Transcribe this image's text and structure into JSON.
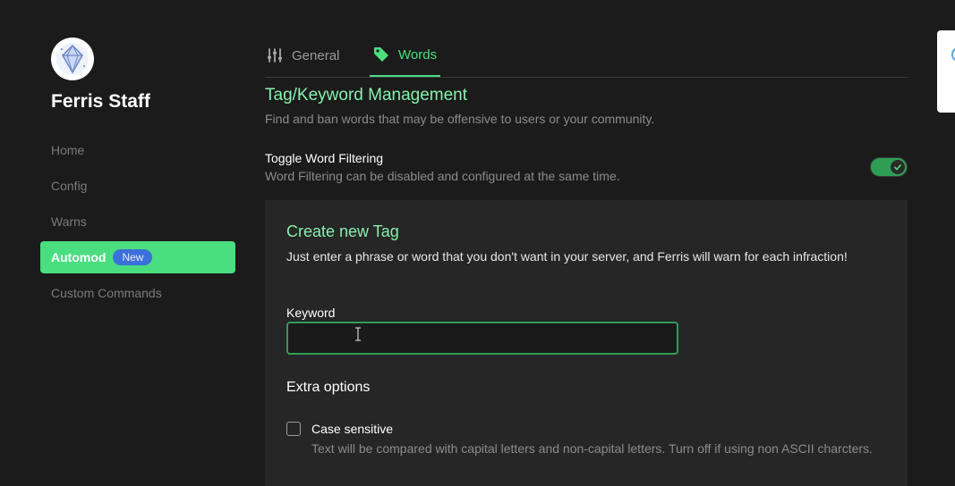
{
  "sidebar": {
    "server_name": "Ferris Staff",
    "items": [
      {
        "label": "Home"
      },
      {
        "label": "Config"
      },
      {
        "label": "Warns"
      },
      {
        "label": "Automod",
        "badge": "New",
        "active": true
      },
      {
        "label": "Custom Commands"
      }
    ]
  },
  "tabs": [
    {
      "label": "General",
      "icon": "sliders-icon"
    },
    {
      "label": "Words",
      "icon": "tag-icon",
      "active": true
    }
  ],
  "section": {
    "title": "Tag/Keyword Management",
    "description": "Find and ban words that may be offensive to users or your community."
  },
  "toggle": {
    "title": "Toggle Word Filtering",
    "description": "Word Filtering can be disabled and configured at the same time.",
    "enabled": true
  },
  "card": {
    "title": "Create new Tag",
    "description": "Just enter a phrase or word that you don't want in your server, and Ferris will warn for each infraction!",
    "keyword_label": "Keyword",
    "keyword_value": "",
    "extra_title": "Extra options",
    "options": [
      {
        "title": "Case sensitive",
        "description": "Text will be compared with capital letters and non-capital letters. Turn off if using non ASCII charcters.",
        "checked": false
      }
    ]
  },
  "colors": {
    "accent": "#4ade80",
    "accent_text": "#86efac",
    "background": "#1b1b1b",
    "card": "#262626",
    "badge": "#3b6fd9"
  }
}
